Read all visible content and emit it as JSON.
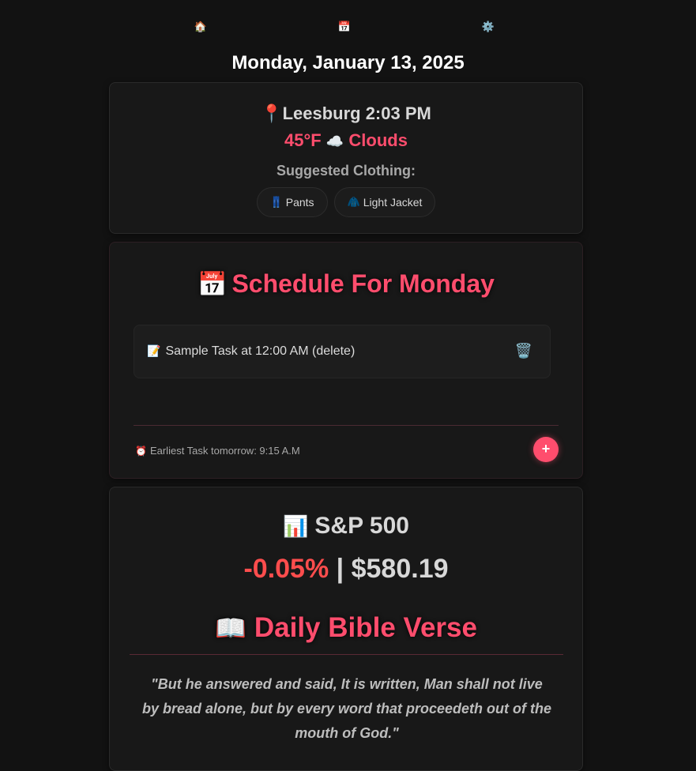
{
  "nav": {
    "home_icon": "🏠",
    "calendar_icon": "📅",
    "settings_icon": "⚙️"
  },
  "date_title": "Monday, January 13, 2025",
  "weather": {
    "location_icon": "📍",
    "location_time": "Leesburg 2:03 PM",
    "temp": "45°F",
    "condition_icon": "☁️",
    "condition": "Clouds",
    "clothing_label": "Suggested Clothing:",
    "clothing": [
      {
        "icon": "👖",
        "label": "Pants"
      },
      {
        "icon": "🧥",
        "label": "Light Jacket"
      }
    ]
  },
  "schedule": {
    "title_icon": "📅",
    "title": "Schedule For Monday",
    "tasks": [
      {
        "icon": "📝",
        "text": "Sample Task at 12:00 AM (delete)",
        "delete_icon": "🗑️"
      }
    ],
    "earliest_icon": "⏰",
    "earliest_text": "Earliest Task tomorrow: 9:15 A.M",
    "add_label": "+"
  },
  "stock": {
    "icon": "📊",
    "name": "S&P 500",
    "change": "-0.05%",
    "separator": " | ",
    "price": "$580.19"
  },
  "verse": {
    "icon": "📖",
    "title": "Daily Bible Verse",
    "text": "\"But he answered and said, It is written, Man shall not live by bread alone, but by every word that proceedeth out of the mouth of God.\""
  },
  "colors": {
    "accent": "#ff4d6d",
    "negative": "#ff4d4d",
    "background": "#121212",
    "card": "#181818"
  }
}
